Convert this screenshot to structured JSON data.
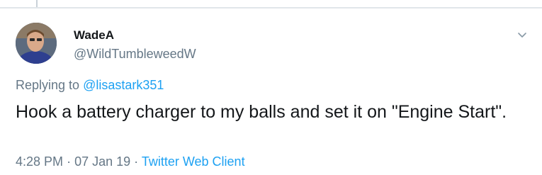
{
  "tweet": {
    "display_name": "WadeA",
    "handle": "@WildTumbleweedW",
    "replying_prefix": "Replying to",
    "replying_to": "@lisastark351",
    "text": "Hook a battery charger to my balls and set it on \"Engine Start\".",
    "time": "4:28 PM",
    "date": "07 Jan 19",
    "separator": "·",
    "source": "Twitter Web Client"
  },
  "icons": {
    "menu": "chevron-down-icon",
    "avatar": "avatar"
  },
  "colors": {
    "text": "#14171a",
    "secondary": "#657786",
    "link": "#1da1f2",
    "divider": "#e1e6ea"
  }
}
